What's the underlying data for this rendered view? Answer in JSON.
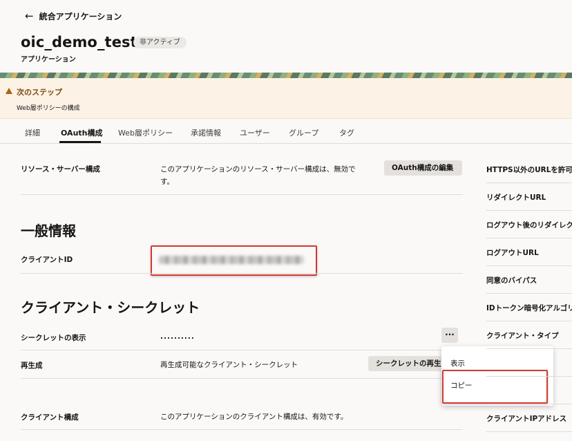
{
  "header": {
    "back_label": "統合アプリケーション",
    "app_title": "oic_demo_test",
    "status_badge": "非アクティブ",
    "subtitle": "アプリケーション"
  },
  "alert": {
    "title": "次のステップ",
    "link": "Web層ポリシーの構成"
  },
  "tabs": [
    {
      "label": "詳細"
    },
    {
      "label": "OAuth構成",
      "active": true
    },
    {
      "label": "Web層ポリシー"
    },
    {
      "label": "承諾情報"
    },
    {
      "label": "ユーザー"
    },
    {
      "label": "グループ"
    },
    {
      "label": "タグ"
    }
  ],
  "resource_server": {
    "label": "リソース・サーバー構成",
    "text_line1": "このアプリケーションのリソース・サーバー構成は、無効で",
    "text_line2": "す。",
    "edit_button": "OAuth構成の編集"
  },
  "general": {
    "section_title": "一般情報",
    "client_id_label": "クライアントID"
  },
  "secret": {
    "section_title": "クライアント・シークレット",
    "show_label": "シークレットの表示",
    "masked_value": "..........",
    "more_button": "···",
    "regen_label": "再生成",
    "regen_text": "再生成可能なクライアント・シークレット",
    "regen_button": "シークレットの再生成",
    "menu": {
      "view": "表示",
      "copy": "コピー"
    }
  },
  "client_config": {
    "label": "クライアント構成",
    "text": "このアプリケーションのクライアント構成は、有効です。"
  },
  "right_column": [
    {
      "label": "HTTPS以外のURLを許可"
    },
    {
      "label": "リダイレクトURL"
    },
    {
      "label": "ログアウト後のリダイレクトURL"
    },
    {
      "label": "ログアウトURL"
    },
    {
      "label": "同意のバイパス"
    },
    {
      "label": "IDトークン暗号化アルゴリズム"
    },
    {
      "label": "クライアント・タイプ"
    },
    {
      "label": "クライアントIPアドレス"
    }
  ],
  "colors": {
    "alert_bg": "#fcf2e6",
    "alert_accent": "#ac630c",
    "highlight_red": "#d23a32",
    "button_bg": "#e4e1dd"
  }
}
